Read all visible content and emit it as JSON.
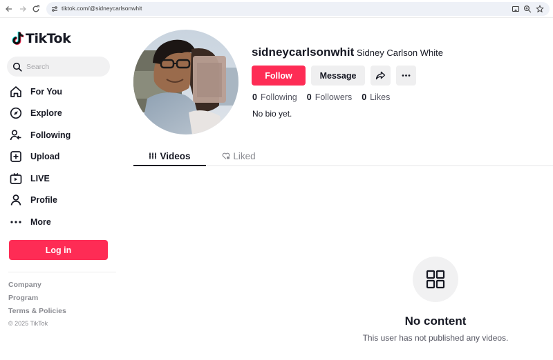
{
  "browser": {
    "url": "tiktok.com/@sidneycarlsonwhit",
    "back_icon": "arrow-left-icon",
    "forward_icon": "arrow-right-icon",
    "reload_icon": "reload-icon"
  },
  "sidebar": {
    "logo_text": "TikTok",
    "search_placeholder": "Search",
    "items": [
      {
        "label": "For You",
        "icon": "home-icon"
      },
      {
        "label": "Explore",
        "icon": "compass-icon"
      },
      {
        "label": "Following",
        "icon": "following-icon"
      },
      {
        "label": "Upload",
        "icon": "upload-icon"
      },
      {
        "label": "LIVE",
        "icon": "live-icon"
      },
      {
        "label": "Profile",
        "icon": "profile-icon"
      },
      {
        "label": "More",
        "icon": "more-icon"
      }
    ],
    "login_label": "Log in",
    "footer": {
      "company": "Company",
      "program": "Program",
      "terms": "Terms & Policies",
      "copyright": "© 2025 TikTok"
    }
  },
  "profile": {
    "username": "sidneycarlsonwhit",
    "nickname": "Sidney Carlson White",
    "follow_label": "Follow",
    "message_label": "Message",
    "stats": {
      "following_count": "0",
      "following_label": "Following",
      "followers_count": "0",
      "followers_label": "Followers",
      "likes_count": "0",
      "likes_label": "Likes"
    },
    "bio": "No bio yet."
  },
  "tabs": [
    {
      "label": "Videos",
      "active": true
    },
    {
      "label": "Liked",
      "active": false
    }
  ],
  "empty_state": {
    "title": "No content",
    "subtitle": "This user has not published any videos."
  },
  "colors": {
    "brand": "#fe2c55",
    "text": "#161823",
    "muted": "#8a8b91"
  }
}
